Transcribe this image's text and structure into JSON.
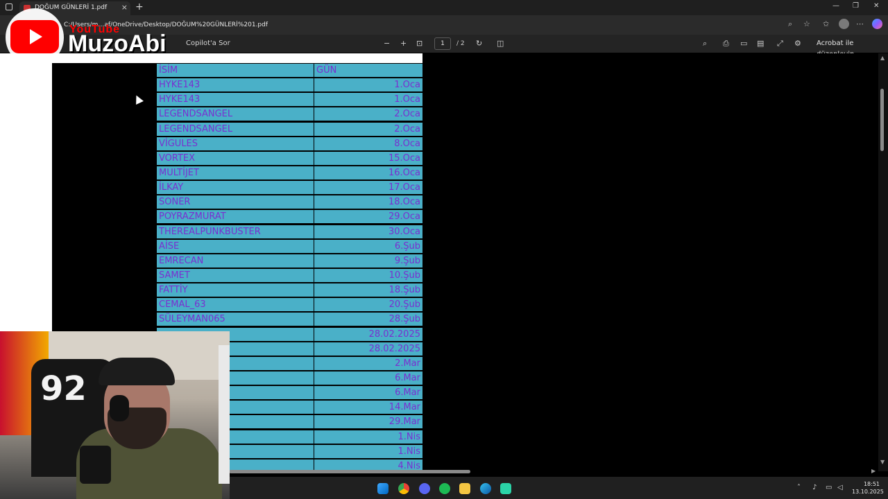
{
  "browser": {
    "tab_title": "DOĞUM GÜNLERİ 1.pdf",
    "tab_close": "×",
    "new_tab": "+",
    "url": "C:/Users/m…af/OneDrive/Desktop/DOĞUM%20GÜNLERİ%201.pdf",
    "win_min": "—",
    "win_max": "❐",
    "win_close": "✕"
  },
  "pdf_toolbar": {
    "ask_copilot": "Copilot'a Sor",
    "zoom_out": "−",
    "zoom_in": "+",
    "current_page": "1",
    "total_pages": "/ 2",
    "acrobat_label": "Acrobat ile düzenleyin"
  },
  "table": {
    "header": {
      "name": "İSİM",
      "day": "GÜN"
    },
    "rows": [
      {
        "name": "HYKE143",
        "day": "1.Oca"
      },
      {
        "name": "HYKE143",
        "day": "1.Oca"
      },
      {
        "name": "LEGENDSANGEL",
        "day": "2.Oca"
      },
      {
        "name": "LEGENDSANGEL",
        "day": "2.Oca"
      },
      {
        "name": "VİGULES",
        "day": "8.Oca"
      },
      {
        "name": "VORTEX",
        "day": "15.Oca"
      },
      {
        "name": "MULTİJET",
        "day": "16.Oca"
      },
      {
        "name": "İLKAY",
        "day": "17.Oca"
      },
      {
        "name": "SONER",
        "day": "18.Oca"
      },
      {
        "name": "POYRAZMURAT",
        "day": "29.Oca"
      },
      {
        "name": "THEREALPUNKBUSTER",
        "day": "30.Oca"
      },
      {
        "name": "AİSE",
        "day": "6.Şub"
      },
      {
        "name": "EMRECAN",
        "day": "9.Şub"
      },
      {
        "name": "SAMET",
        "day": "10.Şub"
      },
      {
        "name": "FATTİY",
        "day": "18.Şub"
      },
      {
        "name": "CEMAL_63",
        "day": "20.Şub"
      },
      {
        "name": "SÜLEYMAN065",
        "day": "28.Şub"
      },
      {
        "name": "",
        "day": "28.02.2025"
      },
      {
        "name": "",
        "day": "28.02.2025"
      },
      {
        "name": "",
        "day": "2.Mar"
      },
      {
        "name": "",
        "day": "6.Mar"
      },
      {
        "name": "",
        "day": "6.Mar"
      },
      {
        "name": "",
        "day": "14.Mar"
      },
      {
        "name": "",
        "day": "29.Mar"
      },
      {
        "name": "",
        "day": "1.Nis"
      },
      {
        "name": "",
        "day": "1.Nis"
      },
      {
        "name": "",
        "day": "4.Nis"
      }
    ]
  },
  "watermark": {
    "youtube": "YouTube",
    "channel": "MuzoAbi"
  },
  "webcam": {
    "chair_number": "92"
  },
  "taskbar": {
    "time": "18:51",
    "date": "13.10.2025"
  },
  "colors": {
    "cell_bg": "#4ab0c8",
    "cell_text": "#7a2fd0"
  }
}
